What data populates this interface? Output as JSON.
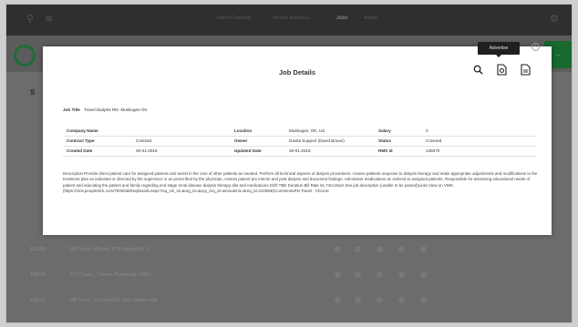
{
  "topbar": {
    "nav": [
      "Talent Channels",
      "Vendor Statistics",
      "Jobs",
      "Admin"
    ],
    "active_nav": "Jobs"
  },
  "background": {
    "side_label": "S",
    "green_button_label": "...",
    "rows": [
      {
        "id": "135100",
        "title": "RN Travel - Chronic TCN Springfield, IL"
      },
      {
        "id": "135098",
        "title": "PCT Travel - Chronic Phoenix AZ #9637"
      },
      {
        "id": "135141",
        "title": "RN Travel - Chronic/ASC Guy's Harbor WA"
      }
    ]
  },
  "modal": {
    "title": "Job Details",
    "tooltip": "Advertise",
    "close_glyph": "x",
    "job_title_label": "Job Title",
    "job_title_value": "Travel Dialysis RN- Muskogee OK",
    "rows": [
      {
        "c1_label": "Company Name",
        "c1_value": "",
        "c2_label": "Location",
        "c2_value": "Muskogee, OK, US",
        "c3_label": "Salary",
        "c3_value": "0"
      },
      {
        "c1_label": "Contract Type",
        "c1_value": "Contract",
        "c2_label": "Owner",
        "c2_value": "Davita Support (David Brown)",
        "c3_label": "Status",
        "c3_value": "Covered"
      },
      {
        "c1_label": "Created Date",
        "c1_value": "25-01-2018",
        "c2_label": "Updated Date",
        "c2_value": "26-01-2018",
        "c3_label": "RMS Id",
        "c3_value": "135070"
      }
    ],
    "description": "Description Provide direct patient care for assigned patients and assist in the care of other patients as needed. Perform all technical aspects of dialysis procedures. Assess patients response to dialysis therapy and make appropriate adjustments and modifications to the treatment plan as indicated or directed by the supervisor or as prescribed by the physician. Assess patient pre interim and post dialysis and document findings. Administer medications as ordered to assigned patients. Responsible for assessing educational needs of patient and educating the patient and family regarding end stage renal disease dialysis therapy diet and medications.Shift TBD Duration Bill Rate 61.74Contact See job description (unable to be parsed)Links View on VMS: (https://vms.peopleclick.com/7000/tabReqDetails.aspx?req_cls_id=&org_id=&cpy_req_id=&resubmit=&req_id=S2366E)CommentsRN Travel - Chronic"
  },
  "icons": {
    "search": "search-icon",
    "advertise": "advertise-icon",
    "document": "document-icon"
  }
}
